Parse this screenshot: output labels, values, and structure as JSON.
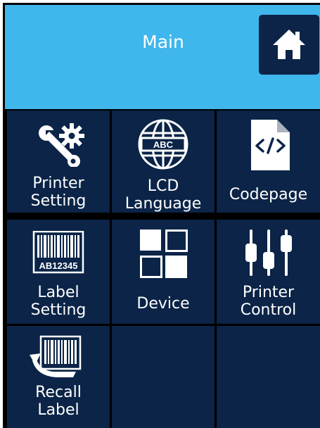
{
  "header": {
    "title": "Main",
    "home_icon": "home-icon"
  },
  "tiles": [
    {
      "name": "printer-setting",
      "icon": "wrench-gear-icon",
      "label": [
        "Printer",
        "Setting"
      ]
    },
    {
      "name": "lcd-language",
      "icon": "globe-abc-icon",
      "label": [
        "LCD",
        "Language"
      ]
    },
    {
      "name": "codepage",
      "icon": "code-file-icon",
      "label": [
        "Codepage"
      ]
    },
    {
      "name": "label-setting",
      "icon": "barcode-icon",
      "label": [
        "Label",
        "Setting"
      ],
      "barcode_text": "AB12345"
    },
    {
      "name": "device",
      "icon": "grid-squares-icon",
      "label": [
        "Device"
      ]
    },
    {
      "name": "printer-control",
      "icon": "sliders-icon",
      "label": [
        "Printer",
        "Control"
      ]
    },
    {
      "name": "recall-label",
      "icon": "recall-barcode-icon",
      "label": [
        "Recall",
        "Label"
      ]
    }
  ],
  "colors": {
    "header": "#3fb6ec",
    "tile": "#0b2447",
    "border": "#000000",
    "text": "#ffffff"
  }
}
